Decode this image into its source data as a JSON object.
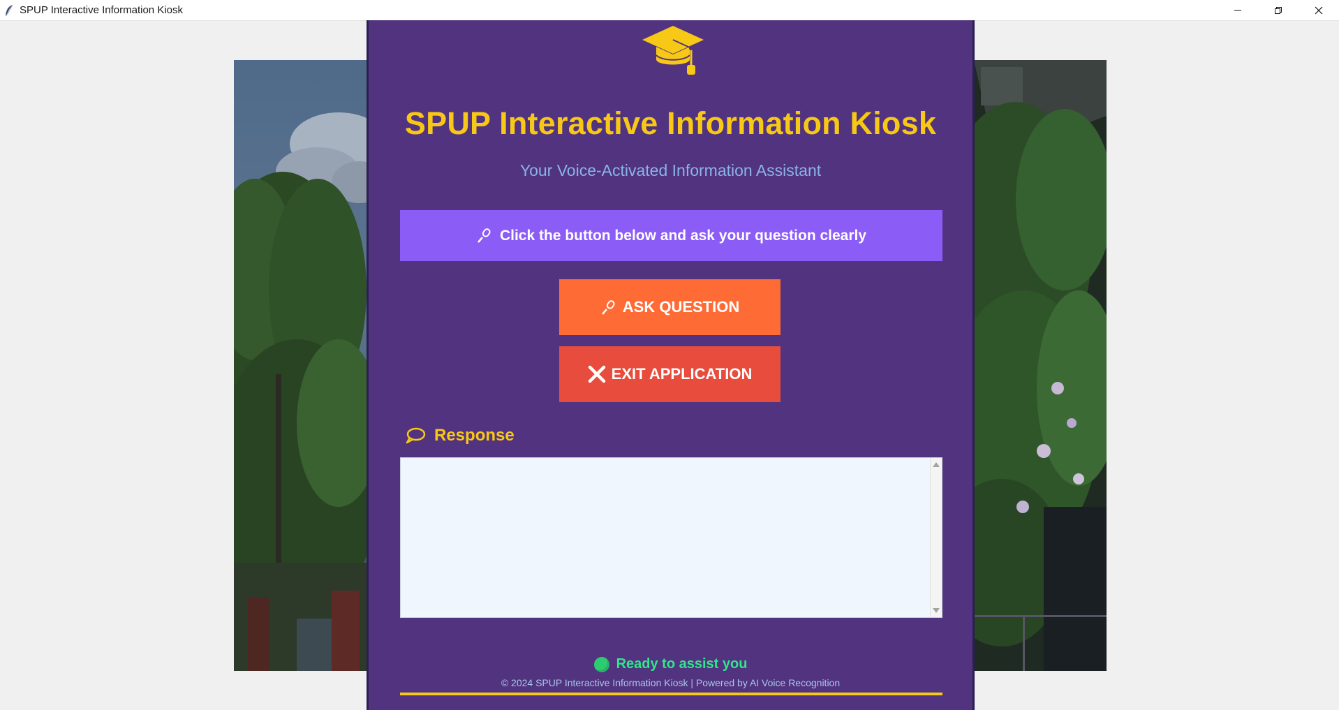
{
  "window": {
    "title": "SPUP Interactive Information Kiosk",
    "controls": [
      "minimize",
      "restore",
      "close"
    ]
  },
  "header": {
    "logo_icon": "graduation-cap-icon",
    "title": "SPUP Interactive Information Kiosk",
    "subtitle": "Your Voice-Activated Information Assistant"
  },
  "instruction": {
    "icon": "microphone-icon",
    "text": "Click the button below and ask your question clearly"
  },
  "buttons": {
    "ask": {
      "icon": "microphone-icon",
      "label": "ASK QUESTION"
    },
    "exit": {
      "icon": "close-x-icon",
      "label": "EXIT APPLICATION"
    }
  },
  "response": {
    "icon": "speech-bubble-icon",
    "label": "Response",
    "text": ""
  },
  "status": {
    "indicator_color": "#2ecc71",
    "text": "Ready to assist you"
  },
  "footer": {
    "text": "© 2024 SPUP Interactive Information Kiosk | Powered by AI Voice Recognition"
  },
  "colors": {
    "panel": "#52337f",
    "accent_yellow": "#f7c815",
    "instruction_bg": "#8b5cf6",
    "ask_button": "#ff6b35",
    "exit_button": "#e74c3c",
    "status_green": "#2ee88a"
  }
}
